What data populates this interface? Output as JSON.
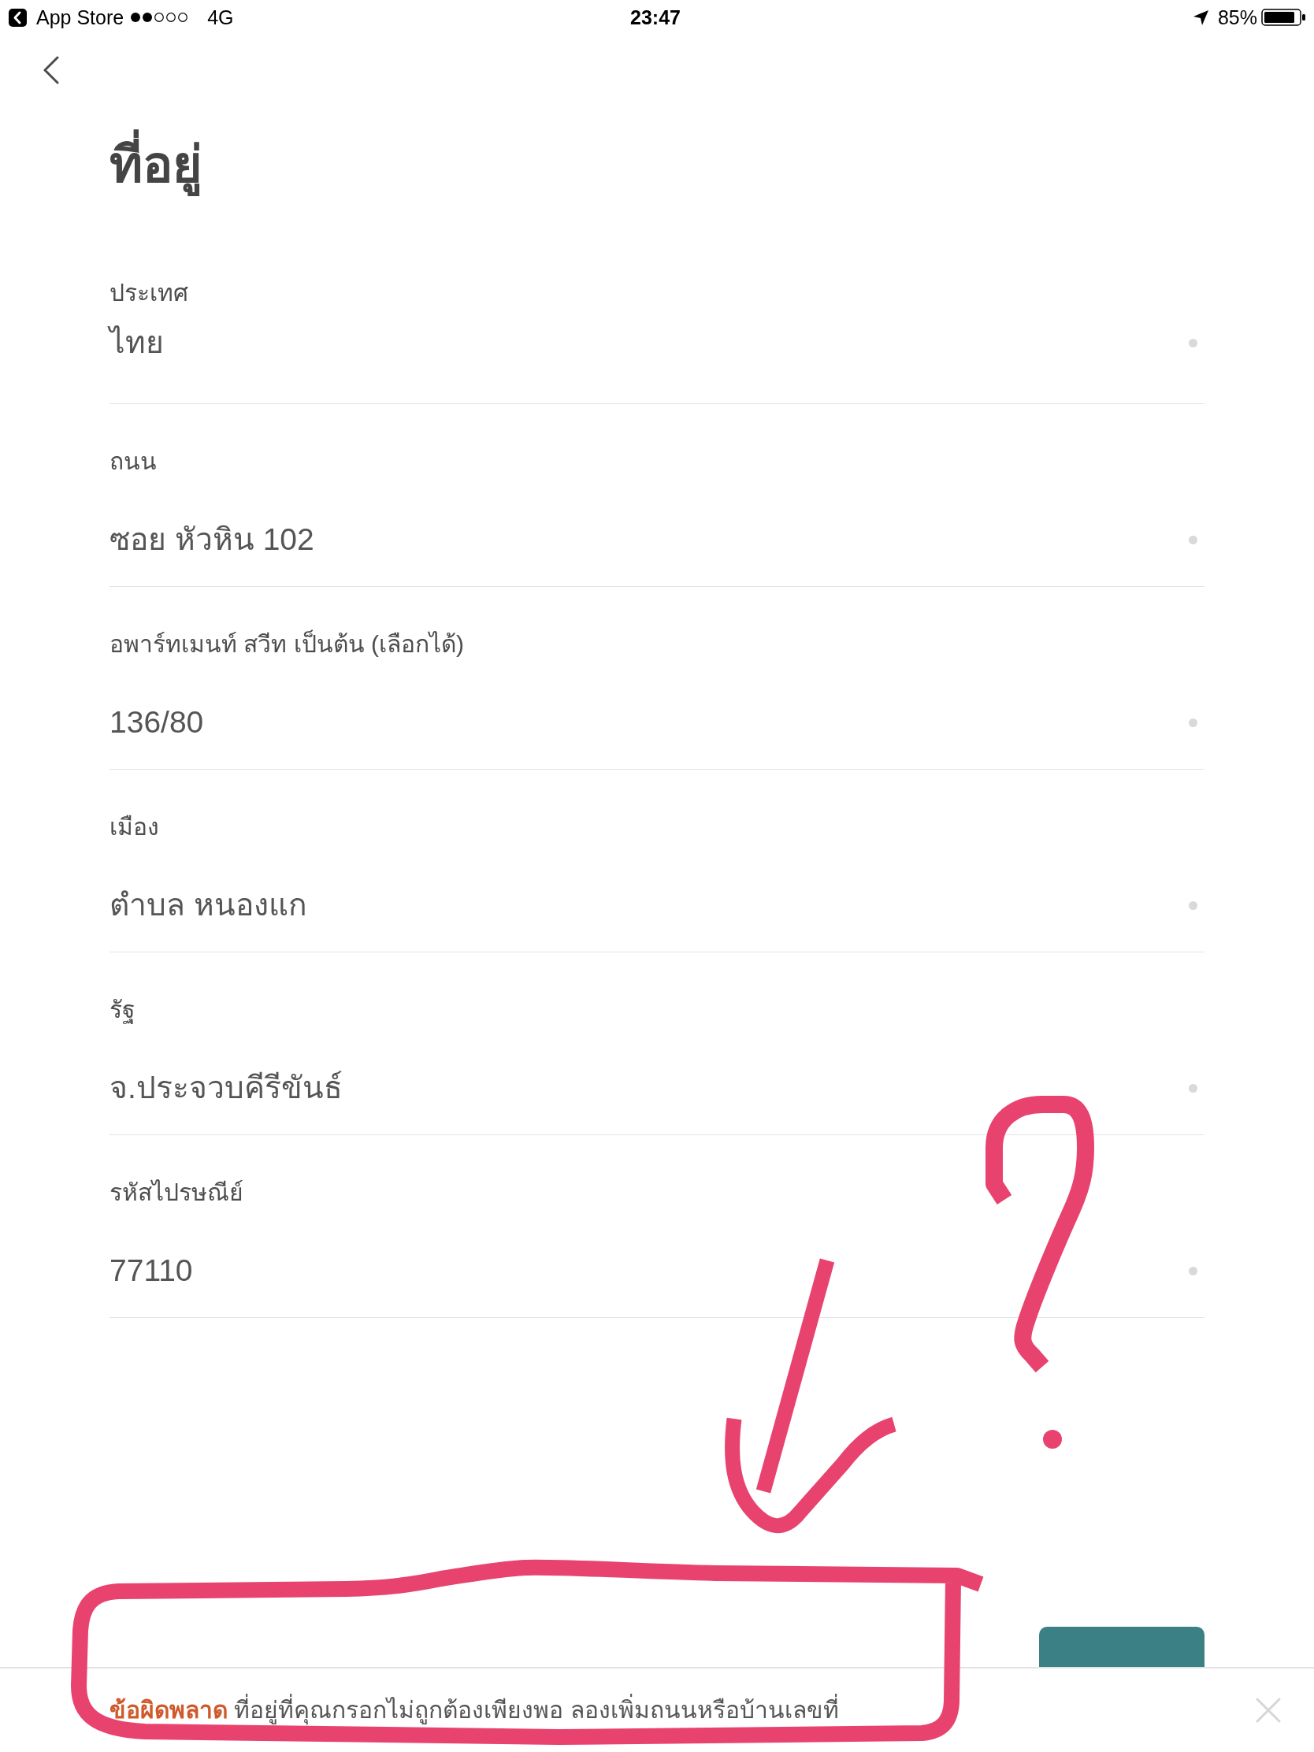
{
  "status_bar": {
    "back_to": "App Store",
    "network": "4G",
    "time": "23:47",
    "battery": "85%"
  },
  "title": "ที่อยู่",
  "fields": [
    {
      "label": "ประเทศ",
      "value": "ไทย"
    },
    {
      "label": "ถนน",
      "value": "ซอย หัวหิน 102"
    },
    {
      "label": "อพาร์ทเมนท์ สวีท เป็นต้น (เลือกได้)",
      "value": "136/80"
    },
    {
      "label": "เมือง",
      "value": "ตำบล หนองแก"
    },
    {
      "label": "รัฐ",
      "value": "จ.ประจวบคีรีขันธ์"
    },
    {
      "label": "รหัสไปรษณีย์",
      "value": "77110"
    }
  ],
  "error_banner": {
    "title": "ข้อผิดพลาด",
    "message": "ที่อยู่ที่คุณกรอกไม่ถูกต้องเพียงพอ ลองเพิ่มถนนหรือบ้านเลขที่"
  },
  "annotations": [
    {
      "kind": "arrow"
    },
    {
      "kind": "question_mark"
    },
    {
      "kind": "frame"
    }
  ]
}
